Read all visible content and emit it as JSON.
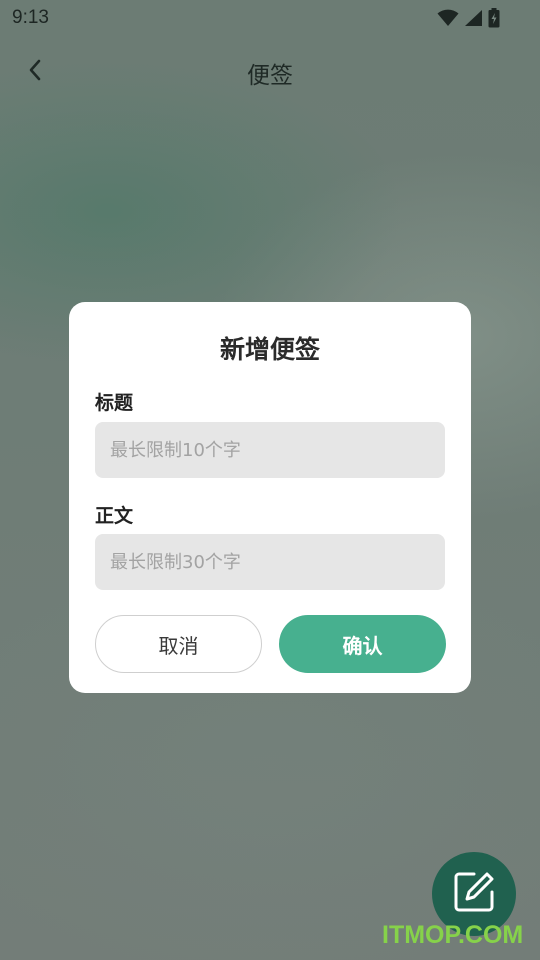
{
  "status_bar": {
    "time": "9:13",
    "icons": [
      "wifi-icon",
      "cell-signal-icon",
      "battery-charging-icon"
    ]
  },
  "app_bar": {
    "back_icon": "chevron-left-icon",
    "title": "便签"
  },
  "dialog": {
    "title": "新增便签",
    "title_field": {
      "label": "标题",
      "value": "",
      "placeholder": "最长限制10个字"
    },
    "body_field": {
      "label": "正文",
      "value": "",
      "placeholder": "最长限制30个字"
    },
    "cancel_label": "取消",
    "confirm_label": "确认"
  },
  "fab": {
    "icon": "edit-icon"
  },
  "watermark": "ITMOP.COM",
  "colors": {
    "accent": "#47b08f",
    "fab": "#20614f",
    "input_bg": "#e6e6e6",
    "watermark": "#86d24a"
  }
}
